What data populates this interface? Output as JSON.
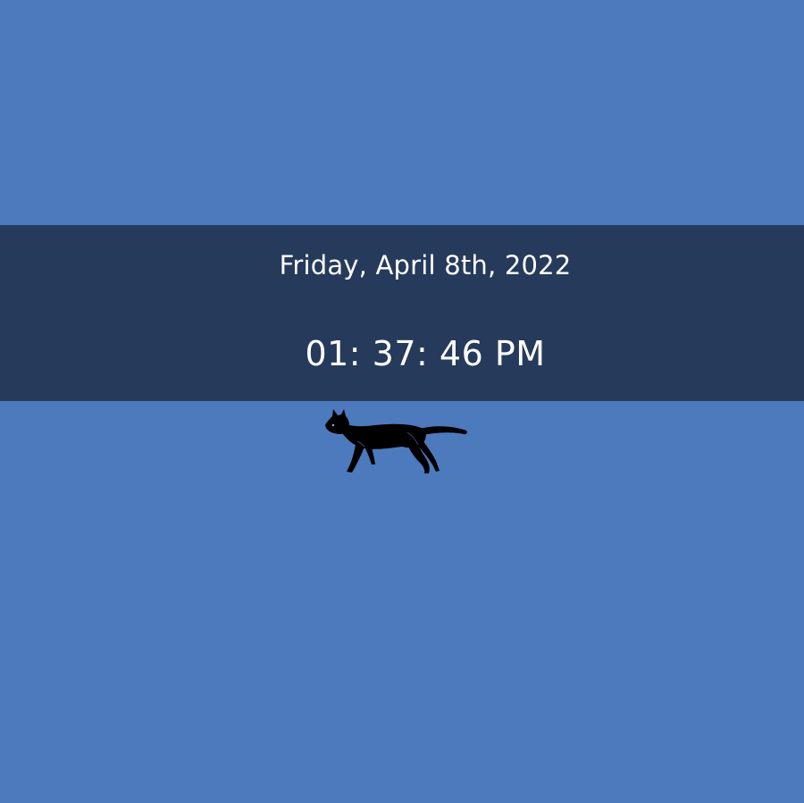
{
  "clock": {
    "date": "Friday, April 8th, 2022",
    "time": "01: 37: 46 PM"
  },
  "theme": {
    "background": "#4d7abd",
    "band": "#263a5b",
    "text": "#ffffff"
  },
  "decoration": {
    "icon": "walking-cat-icon"
  }
}
